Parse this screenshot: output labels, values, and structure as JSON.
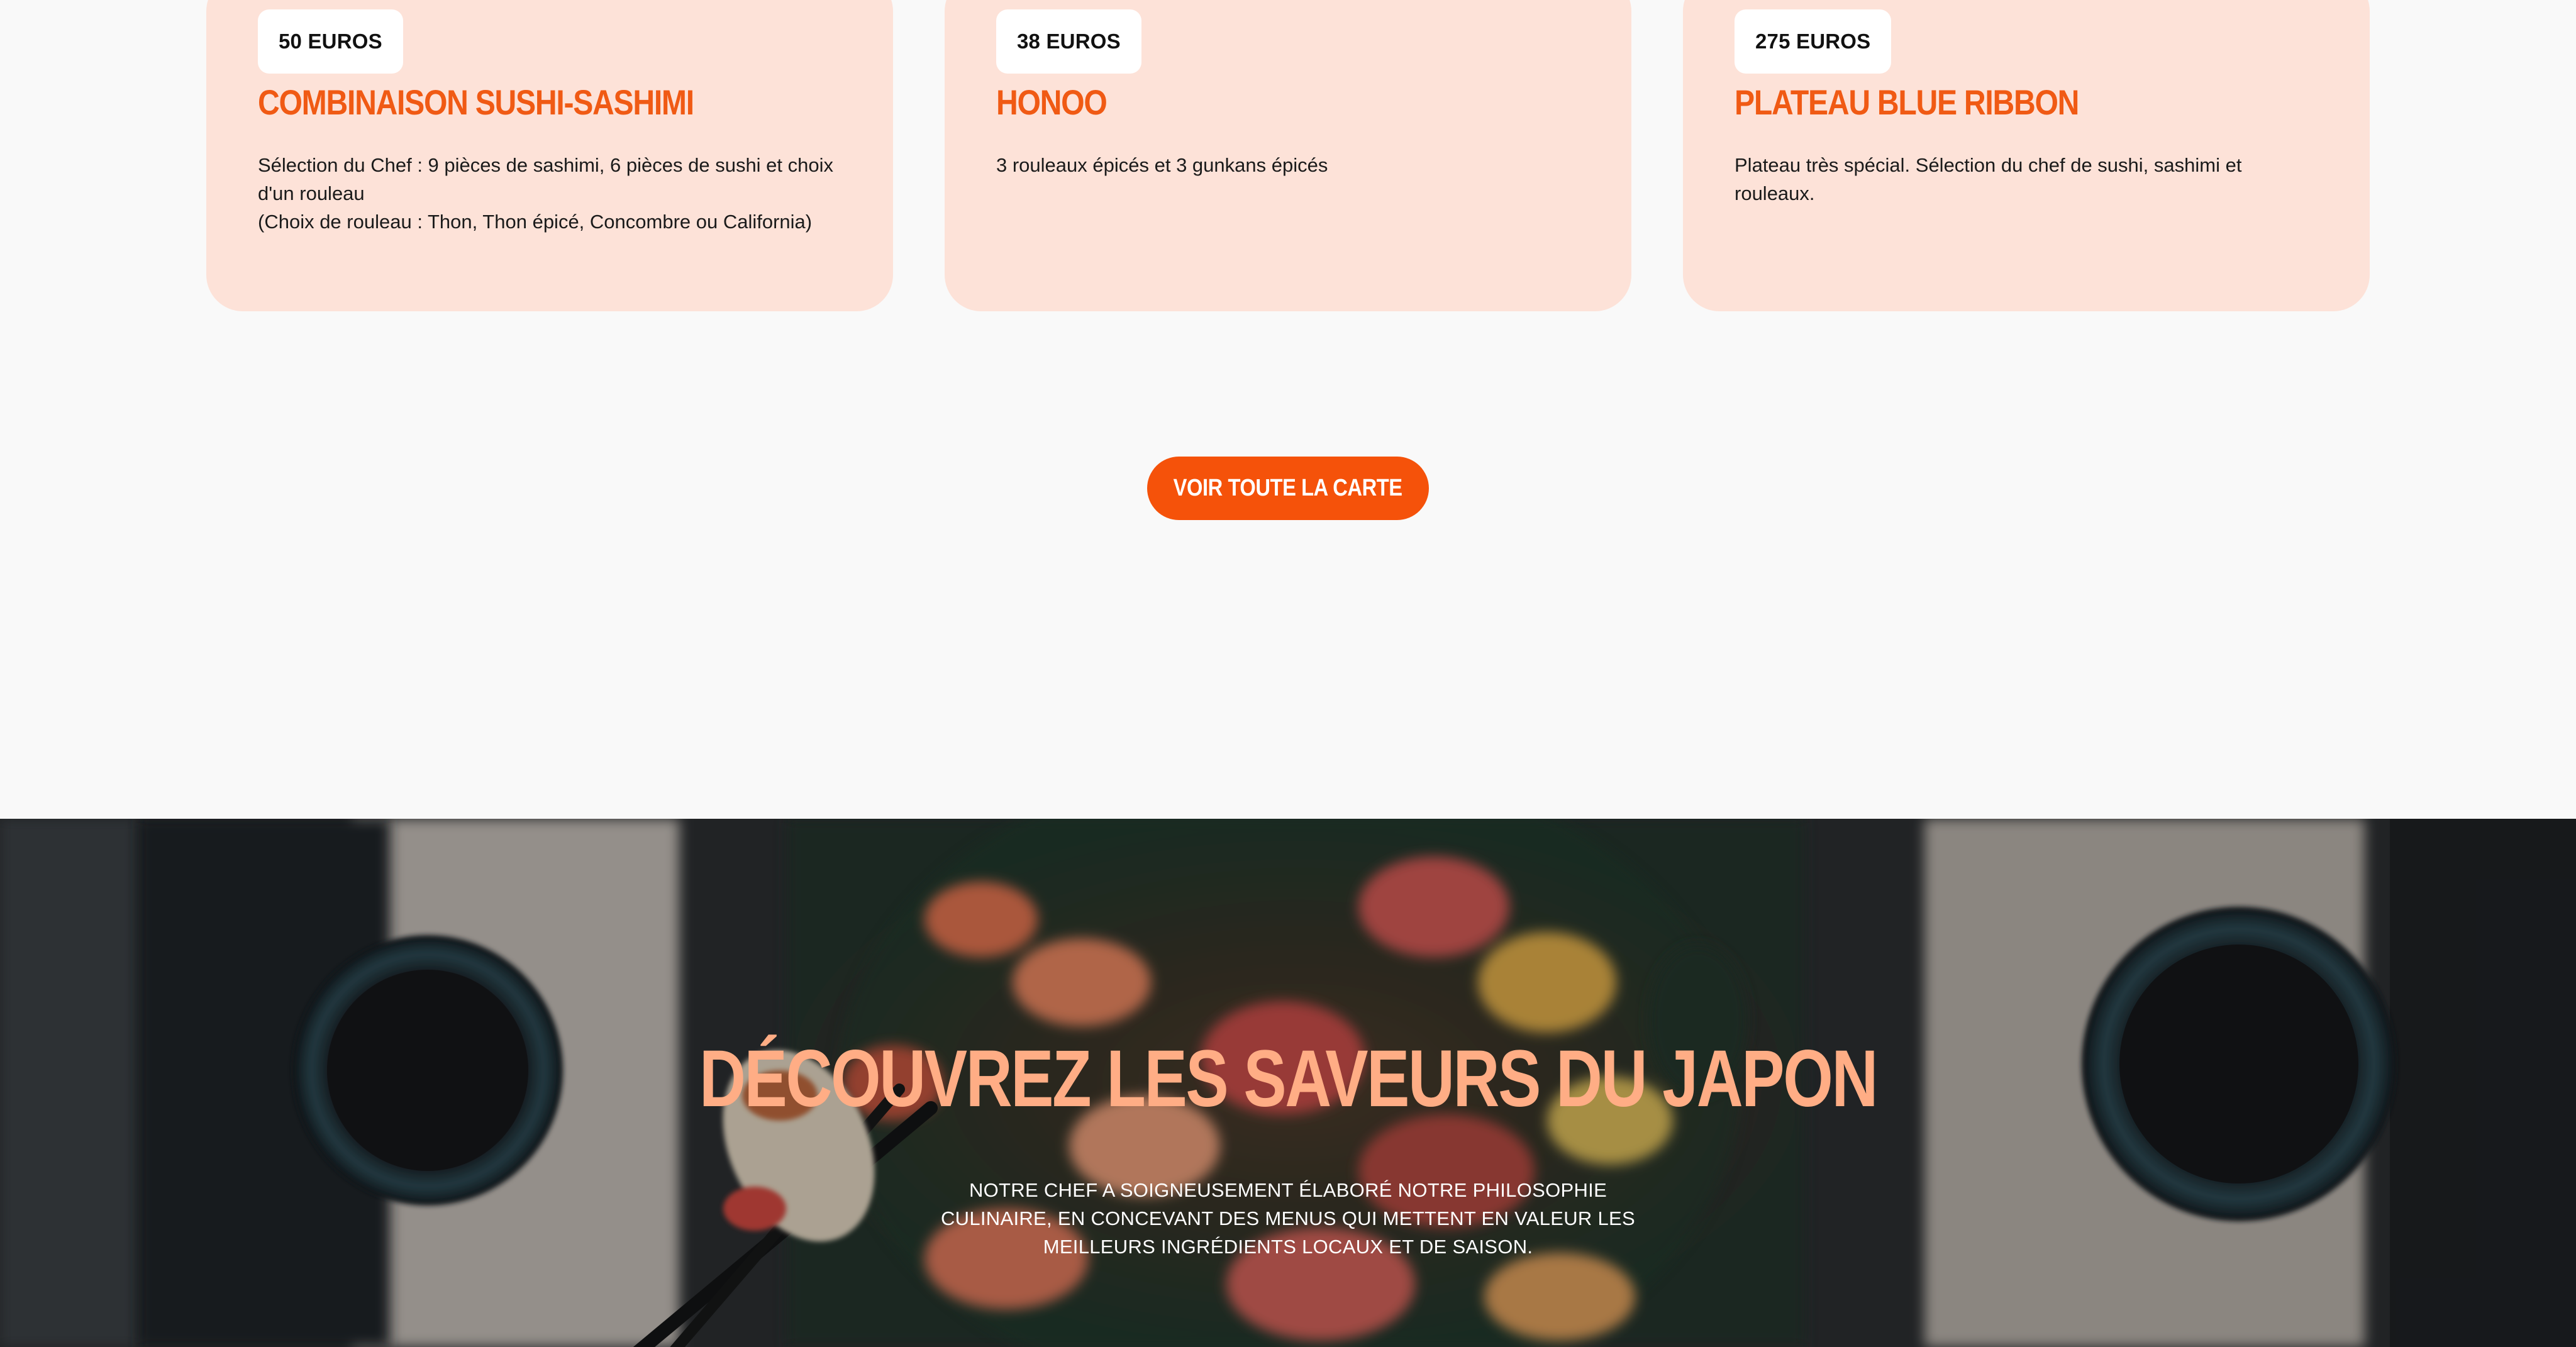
{
  "menu": {
    "cards": [
      {
        "price": "50 EUROS",
        "title": "COMBINAISON SUSHI-SASHIMI",
        "description": "Sélection du Chef : 9 pièces de sashimi, 6 pièces de sushi et choix d'un rouleau\n(Choix de rouleau : Thon, Thon épicé, Concombre ou California)"
      },
      {
        "price": "38 EUROS",
        "title": "HONOO",
        "description": "3 rouleaux épicés et 3 gunkans épicés"
      },
      {
        "price": "275 EUROS",
        "title": "PLATEAU BLUE RIBBON",
        "description": "Plateau très spécial. Sélection du chef de sushi, sashimi et rouleaux."
      }
    ],
    "cta_label": "VOIR TOUTE LA CARTE"
  },
  "hero": {
    "title": "DÉCOUVREZ LES SAVEURS DU JAPON",
    "text": "NOTRE CHEF A SOIGNEUSEMENT ÉLABORÉ NOTRE PHILOSOPHIE CULINAIRE, EN CONCEVANT DES MENUS QUI METTENT EN VALEUR LES MEILLEURS INGRÉDIENTS LOCAUX ET DE SAISON."
  },
  "colors": {
    "card_background": "#fde2d8",
    "accent_orange": "#f05a14",
    "button_orange": "#f5520a",
    "hero_title": "#ffad85",
    "page_background": "#f9f9f9"
  }
}
